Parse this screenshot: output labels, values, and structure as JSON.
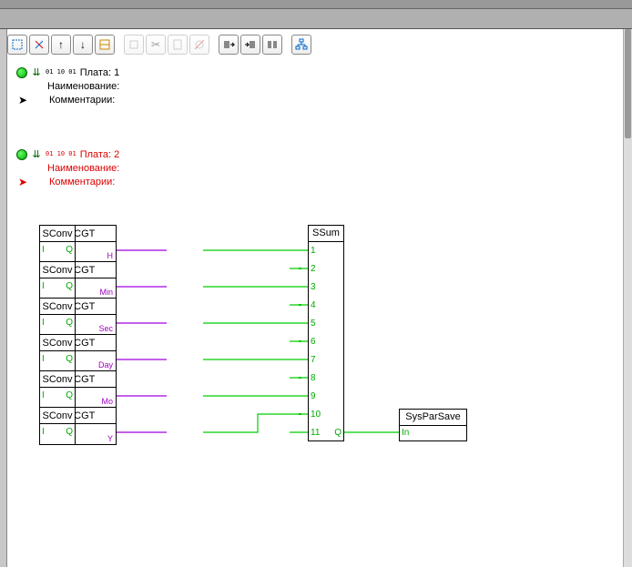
{
  "boards": {
    "b1": {
      "title": "Плата: 1",
      "name_label": "Наименование:",
      "comment_label": "Комментарии:",
      "bits": "01\n10\n01"
    },
    "b2": {
      "title": "Плата: 2",
      "name_label": "Наименование:",
      "comment_label": "Комментарии:",
      "bits": "01\n10\n01"
    }
  },
  "blocks": {
    "rtcgt": {
      "title": "RTCGT",
      "rows": [
        {
          "title": "RTCGT",
          "out": "H"
        },
        {
          "title": "RTCGT",
          "out": "Min"
        },
        {
          "title": "RTCGT",
          "out": "Sec"
        },
        {
          "title": "RTCGT",
          "out": "Day"
        },
        {
          "title": "RTCGT",
          "out": "Mo"
        },
        {
          "title": "RTCGT",
          "out": "Y"
        }
      ]
    },
    "sconv": {
      "title": "SConv",
      "rows": [
        {
          "title": "SConv",
          "in": "I",
          "out": "Q"
        },
        {
          "title": "SConv",
          "in": "I",
          "out": "Q"
        },
        {
          "title": "SConv",
          "in": "I",
          "out": "Q"
        },
        {
          "title": "SConv",
          "in": "I",
          "out": "Q"
        },
        {
          "title": "SConv",
          "in": "I",
          "out": "Q"
        },
        {
          "title": "SConv",
          "in": "I",
          "out": "Q"
        }
      ]
    },
    "ssum": {
      "title": "SSum",
      "pins": [
        "1",
        "2",
        "3",
        "4",
        "5",
        "6",
        "7",
        "8",
        "9",
        "10",
        "11"
      ],
      "out": "Q"
    },
    "syspar": {
      "title": "SysParSave",
      "in": "In"
    }
  },
  "colors": {
    "purple": "#a000e0",
    "green": "#00cc00"
  }
}
